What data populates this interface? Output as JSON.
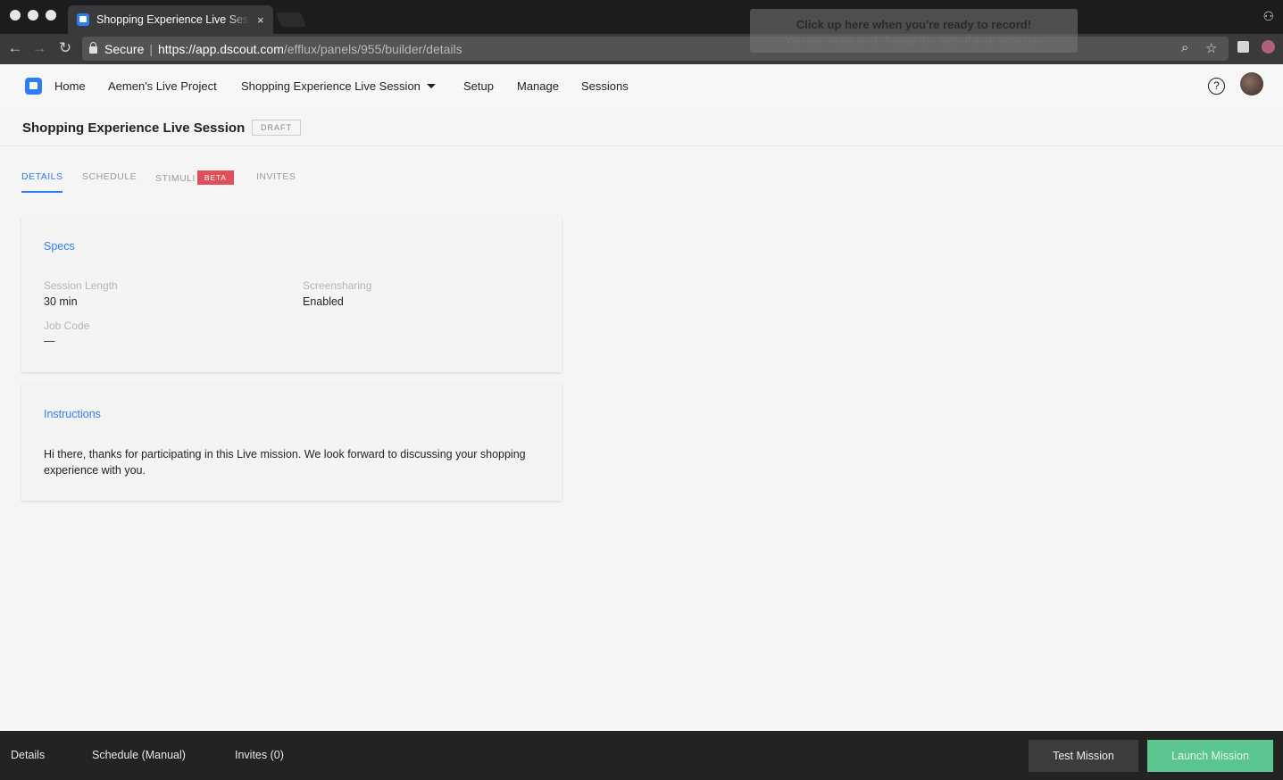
{
  "browser": {
    "tab_title": "Shopping Experience Live Session",
    "tab_close": "×",
    "secure_label": "Secure",
    "url_host": "https://app.dscout.com",
    "url_path": "/efflux/panels/955/builder/details",
    "back_icon": "←",
    "forward_icon": "→",
    "reload_icon": "↻",
    "zoom_icon": "⌕",
    "star_icon": "☆",
    "glasses_icon": "⚇"
  },
  "recorder": {
    "title": "Click up here when you're ready to record!",
    "subtitle": "You can move and change the size of your selection"
  },
  "nav": {
    "home": "Home",
    "project": "Aemen's Live Project",
    "session": "Shopping Experience Live Session",
    "setup": "Setup",
    "manage": "Manage",
    "sessions": "Sessions",
    "help": "?"
  },
  "page": {
    "title": "Shopping Experience Live Session",
    "status_badge": "DRAFT"
  },
  "tabs": {
    "details": "DETAILS",
    "schedule": "SCHEDULE",
    "stimuli": "STIMULI",
    "stimuli_badge": "BETA",
    "invites": "INVITES"
  },
  "specs": {
    "title": "Specs",
    "session_length_label": "Session Length",
    "session_length_value": "30 min",
    "screensharing_label": "Screensharing",
    "screensharing_value": "Enabled",
    "job_code_label": "Job Code",
    "job_code_value": "—"
  },
  "instructions": {
    "title": "Instructions",
    "text": "Hi there, thanks for participating in this Live mission. We look forward to discussing your shopping experience with you."
  },
  "footer": {
    "details": "Details",
    "schedule": "Schedule (Manual)",
    "invites": "Invites (0)",
    "test_button": "Test Mission",
    "launch_button": "Launch Mission"
  },
  "colors": {
    "accent": "#2f7cf6",
    "beta": "#e0505a",
    "launch": "#5bc590"
  }
}
